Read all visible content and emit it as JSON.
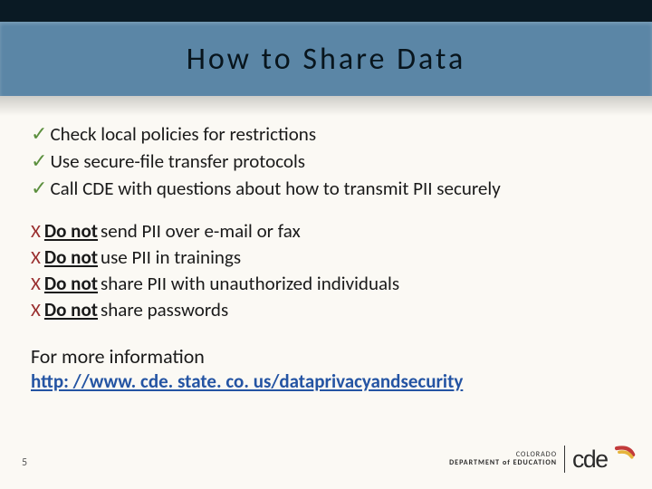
{
  "title": "How to Share Data",
  "checks": [
    "Check local policies for restrictions",
    "Use secure-file transfer protocols",
    "Call CDE with questions about how to transmit PII securely"
  ],
  "dont_prefix": "Do not",
  "donts": [
    "send PII over e-mail or fax",
    "use PII in trainings",
    "share PII with unauthorized individuals",
    "share passwords"
  ],
  "more_info_label": "For more information",
  "link_text": "http: //www. cde. state. co. us/dataprivacyandsecurity",
  "page_number": "5",
  "logo": {
    "state": "COLORADO",
    "dept": "DEPARTMENT of EDUCATION",
    "mark": "cde"
  },
  "glyphs": {
    "check": "✓",
    "x": "X"
  }
}
